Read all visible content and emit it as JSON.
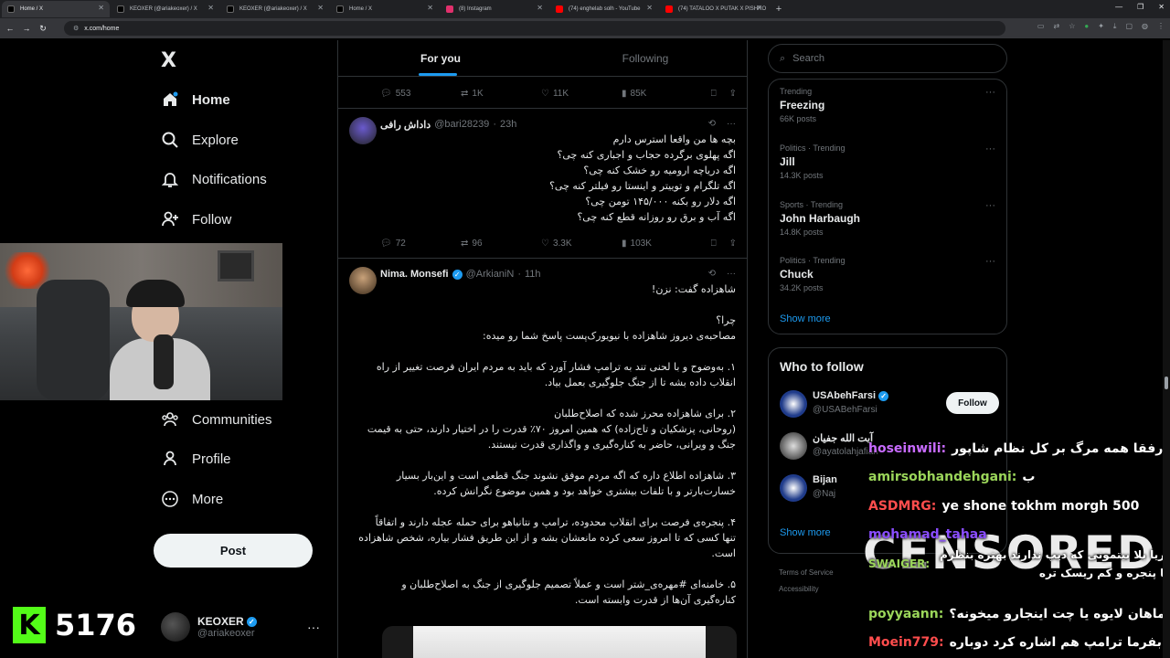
{
  "browser": {
    "tabs": [
      {
        "label": "Home / X",
        "favicon_color": "#000000",
        "active": true
      },
      {
        "label": "KEOXER (@ariakeoxer) / X",
        "favicon_color": "#000000",
        "active": false
      },
      {
        "label": "KEOXER (@ariakeoxer) / X",
        "favicon_color": "#000000",
        "active": false
      },
      {
        "label": "Home / X",
        "favicon_color": "#000000",
        "active": false
      },
      {
        "label": "(8) Instagram",
        "favicon_color": "#e1306c",
        "active": false
      },
      {
        "label": "(74) enghelab solh - YouTube",
        "favicon_color": "#ff0000",
        "active": false
      },
      {
        "label": "(74) TATALOO X PUTAK X PISHRO",
        "favicon_color": "#ff0000",
        "active": false
      }
    ],
    "url": "x.com/home"
  },
  "nav": {
    "logo": "X",
    "items": [
      {
        "label": "Home",
        "icon": "home-icon"
      },
      {
        "label": "Explore",
        "icon": "search-icon"
      },
      {
        "label": "Notifications",
        "icon": "bell-icon"
      },
      {
        "label": "Follow",
        "icon": "person-add-icon"
      },
      {
        "label": "Communities",
        "icon": "communities-icon"
      },
      {
        "label": "Profile",
        "icon": "person-icon"
      },
      {
        "label": "More",
        "icon": "more-circle-icon"
      }
    ],
    "post_label": "Post",
    "account": {
      "name": "KEOXER",
      "handle": "@ariakeoxer"
    }
  },
  "stream": {
    "counter": "5176",
    "badge": "K"
  },
  "feed": {
    "tabs": [
      "For you",
      "Following"
    ],
    "prev_tweet_stats": {
      "replies": "553",
      "reposts": "1K",
      "likes": "11K",
      "views": "85K"
    },
    "tweets": [
      {
        "name": "داداش رافی",
        "handle": "@bari28239",
        "time": "23h",
        "lines": [
          "بچه ها من واقعا استرس دارم",
          "اگه پهلوی برگرده حجاب و اجباری کنه چی؟",
          "اگه دریاچه ارومیه رو خشک کنه چی؟",
          "اگه تلگرام و توییتر و اینستا رو فیلتر کنه چی؟",
          "اگه دلار رو بکنه ۱۴۵/۰۰۰ تومن چی؟",
          "اگه آب و برق رو روزانه قطع کنه چی؟"
        ],
        "stats": {
          "replies": "72",
          "reposts": "96",
          "likes": "3.3K",
          "views": "103K"
        }
      },
      {
        "name": "Nima. Monsefi",
        "handle": "@ArkianiN",
        "time": "11h",
        "lines": [
          "شاهزاده گفت: نزن!",
          "",
          "چرا؟",
          "مصاحبه‌ی دیروز شاهزاده با نیویورک‌پست پاسخ شما رو میده:",
          "",
          "۱. به‌وضوح و با لحنی تند به ترامپ فشار آورد که باید به مردم ایران فرصت تغییر از راه",
          "انقلاب داده بشه تا از جنگ جلوگیری بعمل بیاد.",
          "",
          "۲. برای شاهزاده محرز شده که اصلاح‌طلبان",
          "(روحانی، پزشکیان و تاج‌زاده) که همین امروز ۷۰٪ قدرت را در اختیار دارند، حتی به قیمت",
          "جنگ و ویرانی، حاضر به کناره‌گیری و واگذاری قدرت نیستند.",
          "",
          "۳. شاهزاده اطلاع داره که اگه مردم موفق نشوند جنگ قطعی است و این‌بار بسیار",
          "خسارت‌بارتر و با تلفات بیشتری خواهد بود و همین موضوع نگرانش کرده.",
          "",
          "۴. پنجره‌ی فرصت برای انقلاب محدوده، ترامپ و نتانیاهو برای حمله عجله دارند و اتفاقاً",
          "تنها کسی که تا امروز سعی کرده مانعشان بشه و از این طریق فشار بیاره، شخص شاهزاده",
          "است.",
          "",
          "۵. خامنه‌ای #مهره‌ی_شتر است و عملاً تصمیم جلوگیری از جنگ به اصلاح‌طلبان و",
          "کناره‌گیری آن‌ها از قدرت وابسته است."
        ]
      }
    ]
  },
  "sidebar": {
    "search_placeholder": "Search",
    "trends": [
      {
        "meta": "Trending",
        "title": "Freezing",
        "count": "66K posts"
      },
      {
        "meta": "Politics · Trending",
        "title": "Jill",
        "count": "14.3K posts"
      },
      {
        "meta": "Sports · Trending",
        "title": "John Harbaugh",
        "count": "14.8K posts"
      },
      {
        "meta": "Politics · Trending",
        "title": "Chuck",
        "count": "34.2K posts"
      }
    ],
    "show_more": "Show more",
    "who_to_follow": {
      "title": "Who to follow",
      "suggestions": [
        {
          "name": "USAbehFarsi",
          "handle": "@USABehFarsi"
        },
        {
          "name": "آیت الله جفیان",
          "handle": "@ayatolahjafian"
        },
        {
          "name": "Bijan",
          "handle": "@Naj"
        }
      ],
      "follow_label": "Follow",
      "show_more": "Show more"
    },
    "footer": [
      "Terms of Service",
      "Accessibility"
    ]
  },
  "chat": {
    "censored": "CENSORED",
    "messages": [
      {
        "user": "hoseinwili:",
        "text": "رفقا همه مرگ بر کل نظام شاپور",
        "color": "#c86bff"
      },
      {
        "user": "amirsobhandehgani:",
        "text": "ب",
        "color": "#9bd65a"
      },
      {
        "user": "ASDMRG:",
        "text": "ye shone tokhm morgh 500",
        "color": "#ff4d4d"
      },
      {
        "user": "mohamad_tahaa",
        "text": "",
        "color": "#8a4dff"
      },
      {
        "user": "SWAIGER:",
        "text": "آریا بلا بیتمونی که دیپ ندارند بهتره بنظرم تا پنجره و کم ریسک تره",
        "color": "#9bd65a"
      },
      {
        "user": "poyyaann:",
        "text": "ماهان لایوه یا چت اینجارو میخونه؟",
        "color": "#9bd65a"
      },
      {
        "user": "Moein779:",
        "text": "بفرما ترامپ هم اشاره کرد دوباره",
        "color": "#ff4d4d"
      }
    ]
  }
}
